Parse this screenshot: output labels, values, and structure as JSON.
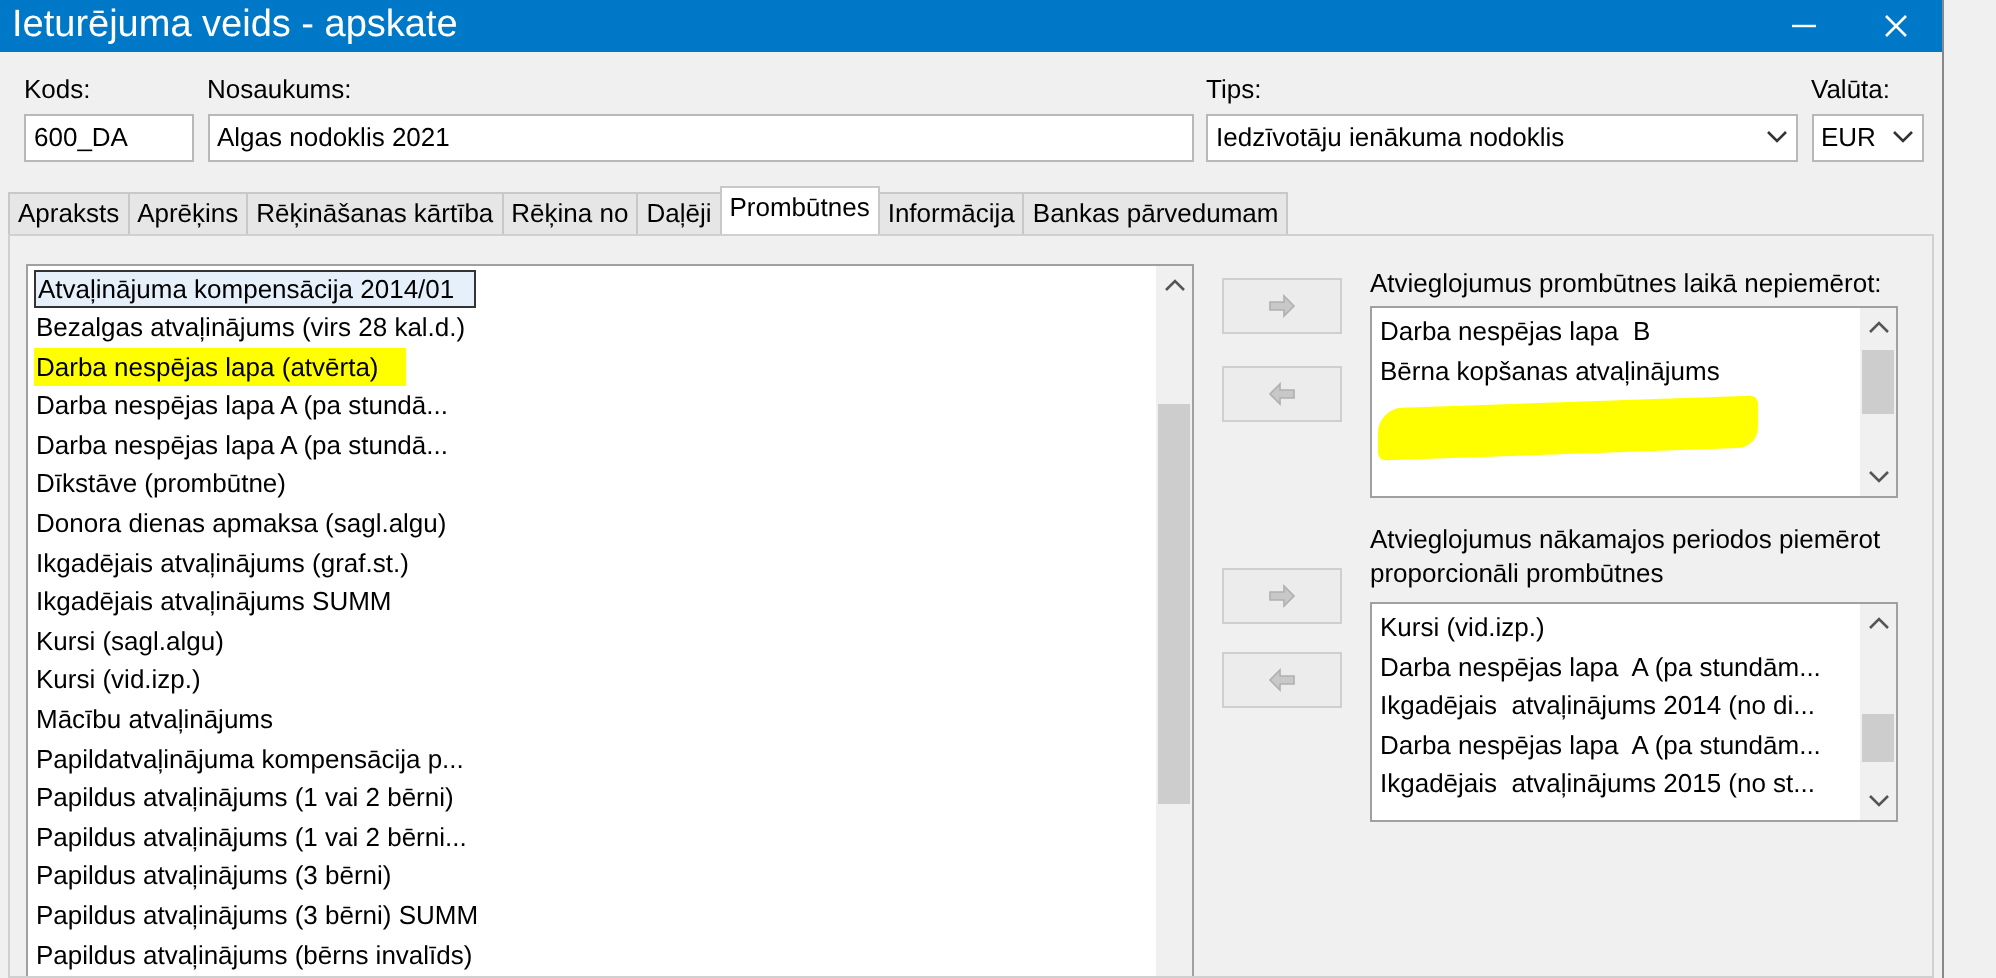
{
  "window": {
    "title": "Ieturējuma veids - apskate"
  },
  "fields": [
    {
      "label": "Kods:",
      "value": "600_DA",
      "kind": "text"
    },
    {
      "label": "Nosaukums:",
      "value": "Algas nodoklis 2021",
      "kind": "text"
    },
    {
      "label": "Tips:",
      "value": "Iedzīvotāju ienākuma nodoklis",
      "kind": "dropdown"
    },
    {
      "label": "Valūta:",
      "value": "EUR",
      "kind": "dropdown"
    }
  ],
  "tabs": [
    {
      "label": "Apraksts",
      "selected": false
    },
    {
      "label": "Aprēķins",
      "selected": false
    },
    {
      "label": "Rēķināšanas kārtība",
      "selected": false
    },
    {
      "label": "Rēķina no",
      "selected": false
    },
    {
      "label": "Daļēji",
      "selected": false
    },
    {
      "label": "Prombūtnes",
      "selected": true
    },
    {
      "label": "Informācija",
      "selected": false
    },
    {
      "label": "Bankas pārvedumam",
      "selected": false
    }
  ],
  "available_list": {
    "items": [
      {
        "text": "Atvaļinājuma kompensācija 2014/01",
        "selected": true,
        "highlighted": false
      },
      {
        "text": "Bezalgas atvaļinājums (virs 28 kal.d.)",
        "selected": false,
        "highlighted": false
      },
      {
        "text": "Darba nespējas lapa  (atvērta)",
        "selected": false,
        "highlighted": true
      },
      {
        "text": "Darba nespējas lapa  A (pa stundā...",
        "selected": false,
        "highlighted": false
      },
      {
        "text": "Darba nespējas lapa  A (pa stundā...",
        "selected": false,
        "highlighted": false
      },
      {
        "text": "Dīkstāve (prombūtne)",
        "selected": false,
        "highlighted": false
      },
      {
        "text": "Donora dienas apmaksa (sagl.algu)",
        "selected": false,
        "highlighted": false
      },
      {
        "text": "Ikgadējais  atvaļinājums (graf.st.)",
        "selected": false,
        "highlighted": false
      },
      {
        "text": "Ikgadējais  atvaļinājums SUMM",
        "selected": false,
        "highlighted": false
      },
      {
        "text": "Kursi (sagl.algu)",
        "selected": false,
        "highlighted": false
      },
      {
        "text": "Kursi (vid.izp.)",
        "selected": false,
        "highlighted": false
      },
      {
        "text": "Mācību  atvaļinājums",
        "selected": false,
        "highlighted": false
      },
      {
        "text": "Papildatvaļinājuma kompensācija p...",
        "selected": false,
        "highlighted": false
      },
      {
        "text": "Papildus atvaļinājums (1 vai 2 bērni)",
        "selected": false,
        "highlighted": false
      },
      {
        "text": "Papildus atvaļinājums (1 vai 2 bērni...",
        "selected": false,
        "highlighted": false
      },
      {
        "text": "Papildus atvaļinājums (3 bērni)",
        "selected": false,
        "highlighted": false
      },
      {
        "text": "Papildus atvaļinājums (3 bērni) SUMM",
        "selected": false,
        "highlighted": false
      },
      {
        "text": "Papildus atvaļinājums (bērns invalīds)",
        "selected": false,
        "highlighted": false
      }
    ]
  },
  "exempt_list": {
    "label": "Atvieglojumus prombūtnes laikā nepiemērot:",
    "scribbled": true,
    "items": [
      {
        "text": "Darba nespējas lapa  B"
      },
      {
        "text": "Bērna kopšanas atvaļinājums"
      }
    ]
  },
  "proportional_list": {
    "label": "Atvieglojumus nākamajos periodos piemērot proporcionāli prombūtnes",
    "items": [
      {
        "text": "Kursi (vid.izp.)"
      },
      {
        "text": "Darba nespējas lapa  A (pa stundām..."
      },
      {
        "text": "Ikgadējais  atvaļinājums 2014 (no di..."
      },
      {
        "text": "Darba nespējas lapa  A (pa stundām..."
      },
      {
        "text": "Ikgadējais  atvaļinājums 2015 (no st..."
      }
    ]
  }
}
